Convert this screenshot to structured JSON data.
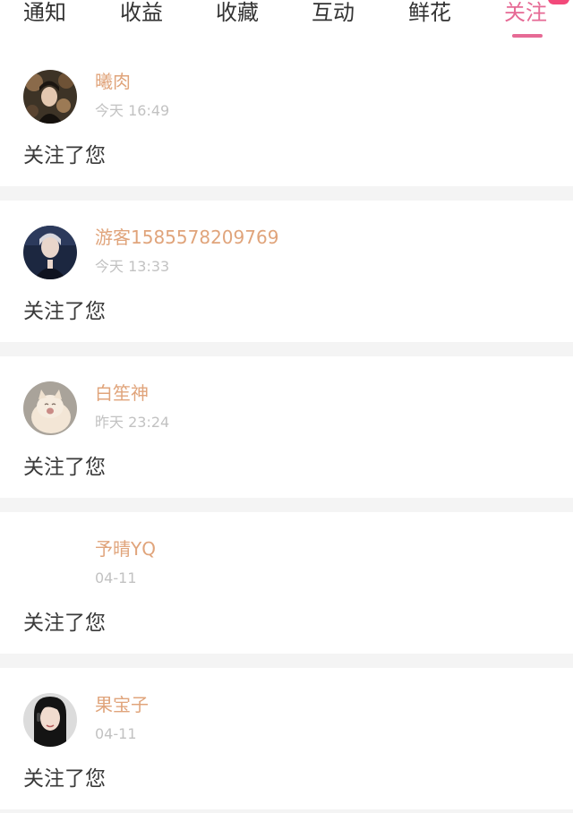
{
  "tabs": [
    {
      "label": "通知"
    },
    {
      "label": "收益"
    },
    {
      "label": "收藏"
    },
    {
      "label": "互动"
    },
    {
      "label": "鲜花"
    },
    {
      "label": "关注",
      "active": true
    }
  ],
  "accent_color": "#e66a95",
  "username_color": "#e0a47b",
  "notifications": [
    {
      "username": "曦肉",
      "time": "今天 16:49",
      "message": "关注了您",
      "avatar": "photo-avatar"
    },
    {
      "username": "游客1585578209769",
      "time": "今天 13:33",
      "message": "关注了您",
      "avatar": "photo-avatar"
    },
    {
      "username": "白笙神",
      "time": "昨天 23:24",
      "message": "关注了您",
      "avatar": "cat-photo-avatar"
    },
    {
      "username": "予晴YQ",
      "time": "04-11",
      "message": "关注了您",
      "avatar": "blank-avatar"
    },
    {
      "username": "果宝子",
      "time": "04-11",
      "message": "关注了您",
      "avatar": "photo-avatar"
    }
  ]
}
